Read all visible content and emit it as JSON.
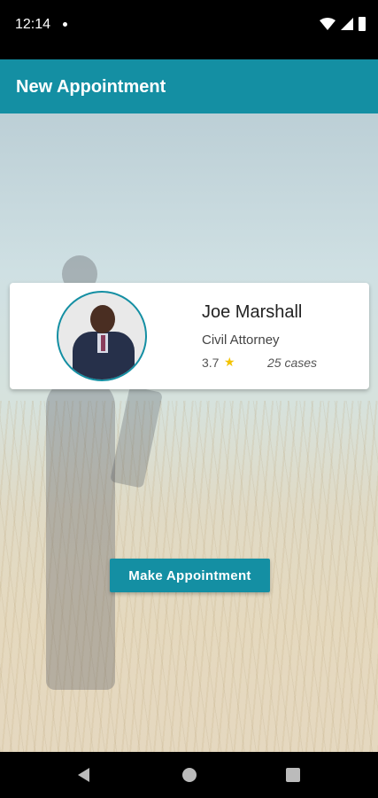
{
  "status_bar": {
    "time": "12:14"
  },
  "app_bar": {
    "title": "New Appointment",
    "color": "#148fa3"
  },
  "lawyer": {
    "name": "Joe Marshall",
    "title": "Civil Attorney",
    "rating": "3.7",
    "cases": "25 cases"
  },
  "actions": {
    "make_appointment_label": "Make Appointment"
  },
  "icons": {
    "wifi": "wifi-icon",
    "signal": "cellular-signal-icon",
    "battery": "battery-icon",
    "star": "star-icon",
    "back": "back-icon",
    "home": "home-icon",
    "recents": "recents-icon"
  }
}
